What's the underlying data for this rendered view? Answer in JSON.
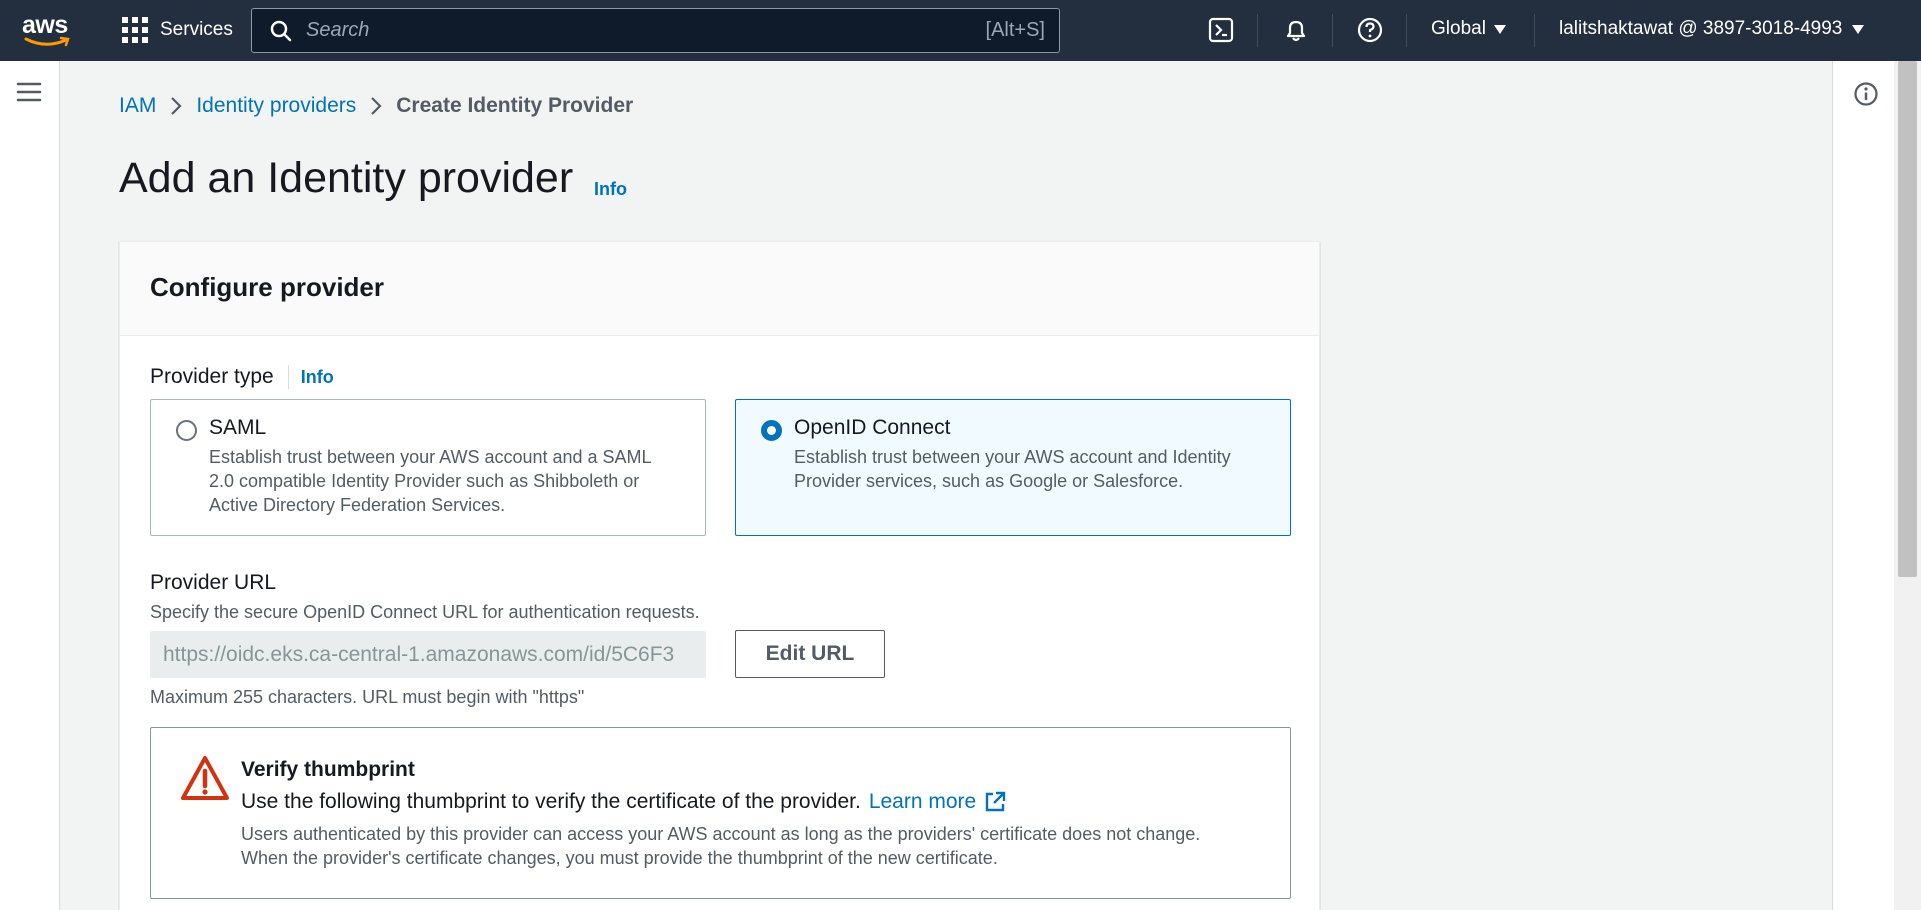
{
  "nav": {
    "logo": "aws",
    "services_label": "Services",
    "search_placeholder": "Search",
    "search_shortcut": "[Alt+S]",
    "region": "Global",
    "account": "lalitshaktawat @ 3897-3018-4993",
    "icons": [
      "cloudshell-icon",
      "bell-icon",
      "help-icon"
    ],
    "bg_color": "#232f3e"
  },
  "breadcrumb": {
    "items": [
      {
        "label": "IAM"
      },
      {
        "label": "Identity providers"
      },
      {
        "label": "Create Identity Provider"
      }
    ]
  },
  "page": {
    "title": "Add an Identity provider",
    "info_label": "Info"
  },
  "panel": {
    "heading": "Configure provider",
    "provider_type": {
      "label": "Provider type",
      "info_label": "Info",
      "options": [
        {
          "title": "SAML",
          "description": "Establish trust between your AWS account and a SAML 2.0 compatible Identity Provider such as Shibboleth or Active Directory Federation Services.",
          "selected": false
        },
        {
          "title": "OpenID Connect",
          "description": "Establish trust between your AWS account and Identity Provider services, such as Google or Salesforce.",
          "selected": true
        }
      ]
    },
    "provider_url": {
      "label": "Provider URL",
      "description": "Specify the secure OpenID Connect URL for authentication requests.",
      "value": "https://oidc.eks.ca-central-1.amazonaws.com/id/5C6F3",
      "edit_button": "Edit URL",
      "hint": "Maximum 255 characters. URL must begin with \"https\""
    },
    "alert": {
      "title": "Verify thumbprint",
      "body": "Use the following thumbprint to verify the certificate of the provider.",
      "link": "Learn more",
      "note": "Users authenticated by this provider can access your AWS account as long as the providers' certificate does not change. When the provider's certificate changes, you must provide the thumbprint of the new certificate."
    }
  },
  "colors": {
    "link": "#0073bb",
    "warning": "#d13212",
    "selected_bg": "#f1faff"
  }
}
